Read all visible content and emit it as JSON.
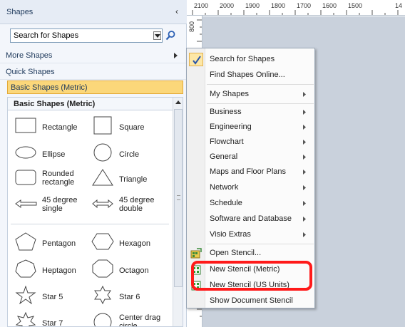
{
  "pane": {
    "title": "Shapes",
    "search_value": "Search for Shapes",
    "more_shapes": "More Shapes",
    "quick_shapes": "Quick Shapes",
    "basic_shapes": "Basic Shapes (Metric)",
    "stencil_title": "Basic Shapes (Metric)"
  },
  "shapes": [
    {
      "label": "Rectangle",
      "icon": "rectangle-icon"
    },
    {
      "label": "Square",
      "icon": "square-icon"
    },
    {
      "label": "Ellipse",
      "icon": "ellipse-icon"
    },
    {
      "label": "Circle",
      "icon": "circle-icon"
    },
    {
      "label": "Rounded rectangle",
      "label_line1": "Rounded",
      "label_line2": "rectangle",
      "icon": "rounded-rectangle-icon"
    },
    {
      "label": "Triangle",
      "icon": "triangle-icon"
    },
    {
      "label": "45 degree single",
      "label_line1": "45 degree",
      "label_line2": "single",
      "icon": "single-arrow-icon"
    },
    {
      "label": "45 degree double",
      "label_line1": "45 degree",
      "label_line2": "double",
      "icon": "double-arrow-icon"
    },
    {
      "label": "Pentagon",
      "icon": "pentagon-icon"
    },
    {
      "label": "Hexagon",
      "icon": "hexagon-icon"
    },
    {
      "label": "Heptagon",
      "icon": "heptagon-icon"
    },
    {
      "label": "Octagon",
      "icon": "octagon-icon"
    },
    {
      "label": "Star 5",
      "icon": "star5-icon"
    },
    {
      "label": "Star 6",
      "icon": "star6-icon"
    },
    {
      "label": "Star 7",
      "icon": "star7-icon"
    },
    {
      "label": "Center drag circle",
      "label_line1": "Center drag",
      "label_line2": "circle",
      "icon": "center-drag-circle-icon"
    }
  ],
  "ruler": {
    "top_labels": [
      "2100",
      "2000",
      "1900",
      "1800",
      "1700",
      "1600",
      "1500",
      "14"
    ],
    "left_label": "800"
  },
  "menu": {
    "search_for_shapes": "Search for Shapes",
    "find_shapes_online": "Find Shapes Online...",
    "my_shapes": "My Shapes",
    "business": "Business",
    "engineering": "Engineering",
    "flowchart": "Flowchart",
    "general": "General",
    "maps_and_floor_plans": "Maps and Floor Plans",
    "network": "Network",
    "schedule": "Schedule",
    "software_and_database": "Software and Database",
    "visio_extras": "Visio Extras",
    "open_stencil": "Open Stencil...",
    "new_stencil_metric": "New Stencil (Metric)",
    "new_stencil_us": "New Stencil (US Units)",
    "show_document_stencil": "Show Document Stencil"
  },
  "colors": {
    "selected_row": "#fbd77a",
    "highlight": "#ff1a1a",
    "canvas": "#c9d1dc"
  }
}
